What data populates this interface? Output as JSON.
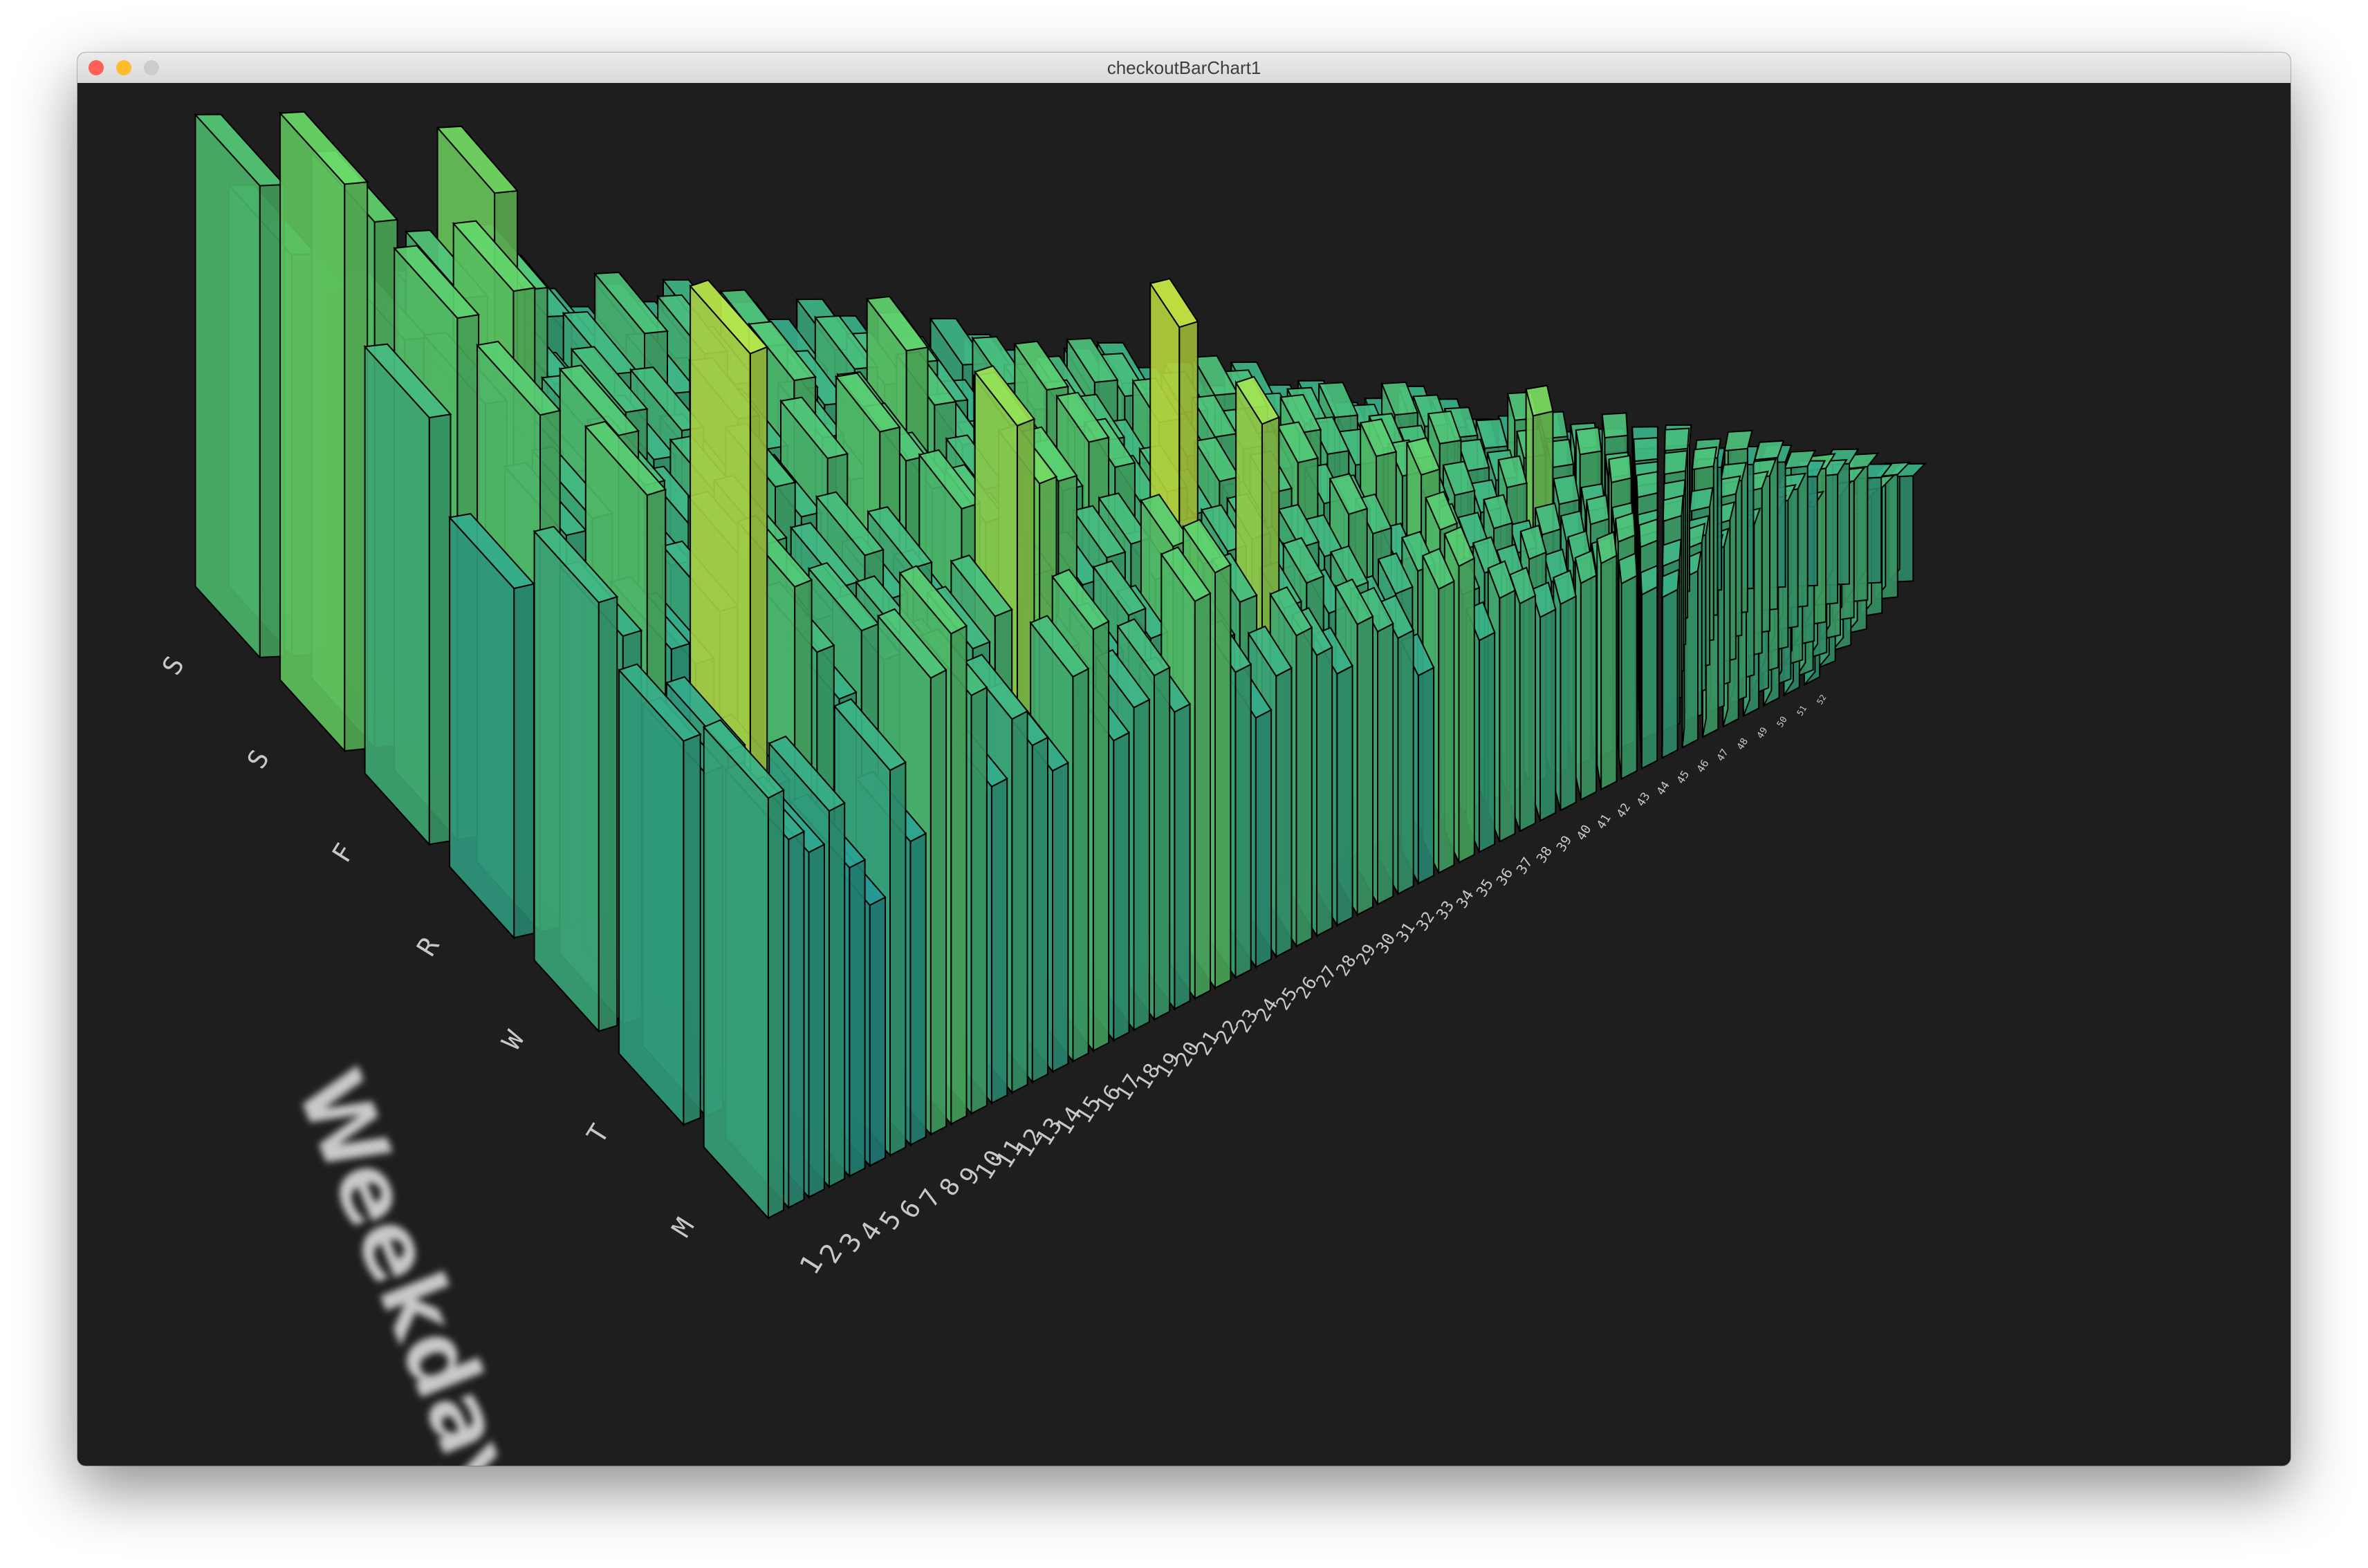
{
  "window": {
    "title": "checkoutBarChart1",
    "buttons": [
      {
        "name": "close",
        "color": "#fe5f57"
      },
      {
        "name": "minimize",
        "color": "#febc2e"
      },
      {
        "name": "zoom",
        "color": "#cccccc"
      }
    ]
  },
  "colors": {
    "background": "#1e1e1e",
    "label": "#c8c8c8",
    "edge": "#000000"
  },
  "chart_data": {
    "type": "bar3d",
    "xlabel": "Weekday",
    "ylabel": "",
    "zlabel": "",
    "weekday_ticks": [
      "M",
      "T",
      "W",
      "R",
      "F",
      "S",
      "S"
    ],
    "week_ticks": [
      "1",
      "2",
      "3",
      "4",
      "5",
      "6",
      "7",
      "8",
      "9",
      "10",
      "11",
      "12",
      "13",
      "14",
      "15",
      "16",
      "17",
      "18",
      "19",
      "20",
      "21",
      "22",
      "23",
      "24",
      "25",
      "26",
      "27",
      "28",
      "29",
      "30",
      "31",
      "32",
      "33",
      "34",
      "35",
      "36",
      "37",
      "38",
      "39",
      "40",
      "41",
      "42",
      "43",
      "44",
      "45",
      "46",
      "47",
      "48",
      "49",
      "50",
      "51",
      "52"
    ],
    "colormap": "viridis",
    "values": [
      [
        45,
        40,
        38,
        42,
        35,
        30,
        45,
        36,
        55,
        60,
        52,
        40,
        48,
        44,
        40,
        52,
        58,
        42,
        46,
        50,
        44,
        60,
        64,
        48,
        40,
        46,
        52,
        48,
        44,
        52,
        50,
        48,
        40,
        56,
        60,
        44,
        52,
        50,
        46,
        48,
        52,
        56,
        50,
        46,
        44,
        48,
        52,
        50,
        46,
        48,
        44,
        42
      ],
      [
        42,
        38,
        40,
        85,
        35,
        58,
        50,
        44,
        52,
        48,
        50,
        42,
        44,
        48,
        52,
        78,
        70,
        46,
        40,
        44,
        50,
        46,
        60,
        48,
        44,
        50,
        80,
        48,
        52,
        46,
        50,
        44,
        48,
        52,
        60,
        46,
        50,
        48,
        52,
        46,
        50,
        48,
        54,
        52,
        46,
        50,
        48,
        52,
        46,
        44,
        50,
        46
      ],
      [
        48,
        44,
        60,
        42,
        40,
        46,
        52,
        54,
        40,
        44,
        48,
        52,
        46,
        50,
        44,
        58,
        56,
        52,
        48,
        62,
        46,
        50,
        52,
        46,
        88,
        48,
        50,
        52,
        46,
        50,
        48,
        56,
        52,
        46,
        64,
        50,
        48,
        52,
        46,
        50,
        48,
        52,
        50,
        48,
        52,
        46,
        50,
        48,
        52,
        50,
        46,
        48
      ],
      [
        40,
        60,
        46,
        48,
        58,
        52,
        42,
        46,
        50,
        44,
        52,
        48,
        56,
        40,
        60,
        56,
        52,
        44,
        52,
        62,
        48,
        52,
        60,
        56,
        50,
        52,
        48,
        54,
        46,
        52,
        58,
        50,
        48,
        60,
        56,
        50,
        52,
        48,
        54,
        72,
        50,
        48,
        56,
        52,
        50,
        48,
        52,
        54,
        50,
        48,
        52,
        50
      ],
      [
        50,
        62,
        52,
        66,
        46,
        44,
        48,
        52,
        46,
        50,
        44,
        52,
        48,
        58,
        50,
        44,
        52,
        64,
        56,
        50,
        46,
        52,
        60,
        54,
        52,
        48,
        56,
        50,
        54,
        52,
        48,
        56,
        52,
        50,
        54,
        52,
        56,
        50,
        48,
        54,
        52,
        56,
        50,
        48,
        52,
        54,
        50,
        52,
        48,
        56,
        52,
        50
      ],
      [
        68,
        64,
        50,
        44,
        56,
        70,
        58,
        46,
        42,
        48,
        54,
        46,
        52,
        48,
        54,
        48,
        46,
        52,
        50,
        54,
        48,
        44,
        52,
        48,
        50,
        54,
        52,
        46,
        50,
        54,
        52,
        48,
        50,
        52,
        48,
        54,
        52,
        50,
        48,
        56,
        52,
        50,
        54,
        48,
        52,
        50,
        54,
        52,
        50,
        48,
        52,
        50
      ],
      [
        58,
        50,
        46,
        42,
        40,
        38,
        42,
        44,
        40,
        46,
        42,
        40,
        44,
        42,
        46,
        40,
        44,
        42,
        46,
        44,
        40,
        42,
        46,
        44,
        42,
        40,
        44,
        46,
        42,
        44,
        40,
        46,
        42,
        44,
        40,
        42,
        46,
        44,
        40,
        42,
        44,
        40,
        42,
        44,
        46,
        40,
        42,
        44,
        40,
        46,
        42,
        44
      ]
    ],
    "zlim": [
      0,
      100
    ]
  }
}
